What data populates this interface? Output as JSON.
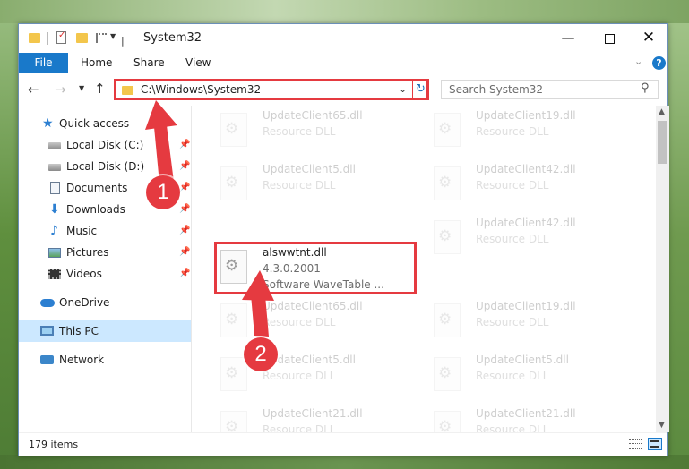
{
  "window": {
    "title": "System32"
  },
  "ribbon": {
    "tabs": [
      "File",
      "Home",
      "Share",
      "View"
    ],
    "help": "?"
  },
  "nav": {
    "address": "C:\\Windows\\System32",
    "search_placeholder": "Search System32"
  },
  "sidebar": {
    "items": [
      {
        "label": "Quick access"
      },
      {
        "label": "Local Disk (C:)"
      },
      {
        "label": "Local Disk (D:)"
      },
      {
        "label": "Documents"
      },
      {
        "label": "Downloads"
      },
      {
        "label": "Music"
      },
      {
        "label": "Pictures"
      },
      {
        "label": "Videos"
      },
      {
        "label": "OneDrive"
      },
      {
        "label": "This PC"
      },
      {
        "label": "Network"
      }
    ]
  },
  "files": {
    "highlighted": {
      "name": "alswwtnt.dll",
      "version": "4.3.0.2001",
      "description": "Software WaveTable ..."
    },
    "faded": [
      {
        "name": "UpdateClient65.dll",
        "type": "Resource DLL"
      },
      {
        "name": "UpdateClient19.dll",
        "type": "Resource DLL"
      },
      {
        "name": "UpdateClient5.dll",
        "type": "Resource DLL"
      },
      {
        "name": "UpdateClient42.dll",
        "type": "Resource DLL"
      },
      {
        "name": "UpdateClient42.dll",
        "type": "Resource DLL"
      },
      {
        "name": "UpdateClient65.dll",
        "type": "Resource DLL"
      },
      {
        "name": "UpdateClient19.dll",
        "type": "Resource DLL"
      },
      {
        "name": "UpdateClient5.dll",
        "type": "Resource DLL"
      },
      {
        "name": "UpdateClient5.dll",
        "type": "Resource DLL"
      },
      {
        "name": "UpdateClient21.dll",
        "type": "Resource DLL"
      },
      {
        "name": "UpdateClient21.dll",
        "type": "Resource DLL"
      }
    ]
  },
  "status": {
    "item_count": "179 items"
  },
  "annotations": {
    "step1": "1",
    "step2": "2"
  },
  "colors": {
    "accent": "#1979ca",
    "highlight": "#e53a40",
    "selection": "#cce8ff"
  }
}
